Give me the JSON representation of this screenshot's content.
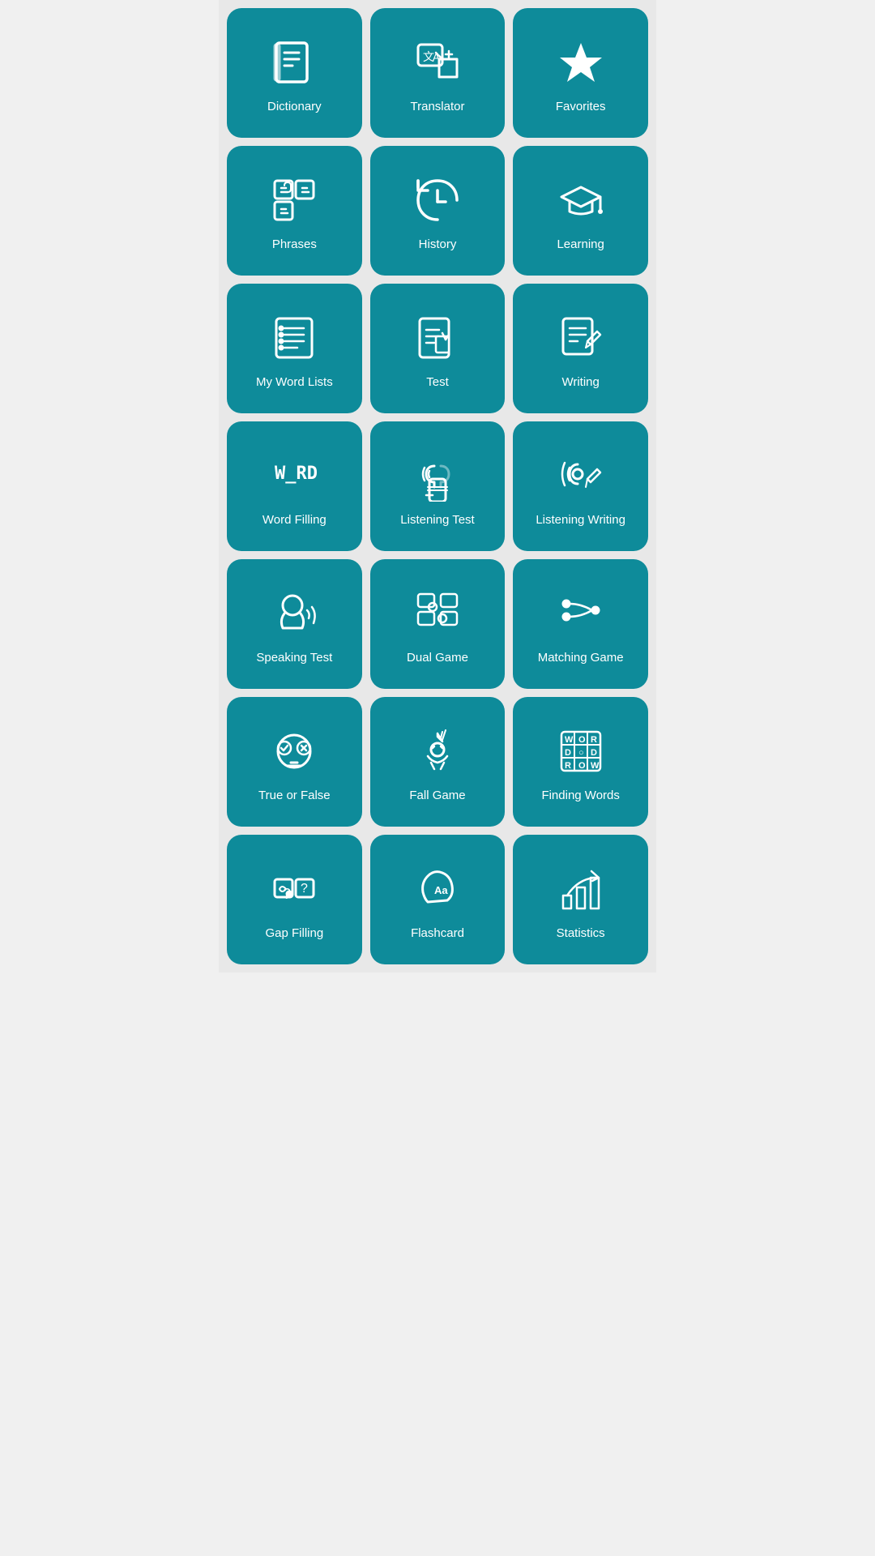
{
  "tiles": [
    {
      "id": "dictionary",
      "label": "Dictionary",
      "icon": "dictionary"
    },
    {
      "id": "translator",
      "label": "Translator",
      "icon": "translator"
    },
    {
      "id": "favorites",
      "label": "Favorites",
      "icon": "favorites"
    },
    {
      "id": "phrases",
      "label": "Phrases",
      "icon": "phrases"
    },
    {
      "id": "history",
      "label": "History",
      "icon": "history"
    },
    {
      "id": "learning",
      "label": "Learning",
      "icon": "learning"
    },
    {
      "id": "my-word-lists",
      "label": "My Word Lists",
      "icon": "wordlists"
    },
    {
      "id": "test",
      "label": "Test",
      "icon": "test"
    },
    {
      "id": "writing",
      "label": "Writing",
      "icon": "writing"
    },
    {
      "id": "word-filling",
      "label": "Word Filling",
      "icon": "wordfilling"
    },
    {
      "id": "listening-test",
      "label": "Listening Test",
      "icon": "listeningtest"
    },
    {
      "id": "listening-writing",
      "label": "Listening Writing",
      "icon": "listeningwriting"
    },
    {
      "id": "speaking-test",
      "label": "Speaking Test",
      "icon": "speakingtest"
    },
    {
      "id": "dual-game",
      "label": "Dual Game",
      "icon": "dualgame"
    },
    {
      "id": "matching-game",
      "label": "Matching Game",
      "icon": "matchinggame"
    },
    {
      "id": "true-or-false",
      "label": "True or False",
      "icon": "trueorfalse"
    },
    {
      "id": "fall-game",
      "label": "Fall Game",
      "icon": "fallgame"
    },
    {
      "id": "finding-words",
      "label": "Finding Words",
      "icon": "findingwords"
    },
    {
      "id": "gap-filling",
      "label": "Gap Filling",
      "icon": "gapfilling"
    },
    {
      "id": "flashcard",
      "label": "Flashcard",
      "icon": "flashcard"
    },
    {
      "id": "statistics",
      "label": "Statistics",
      "icon": "statistics"
    }
  ]
}
